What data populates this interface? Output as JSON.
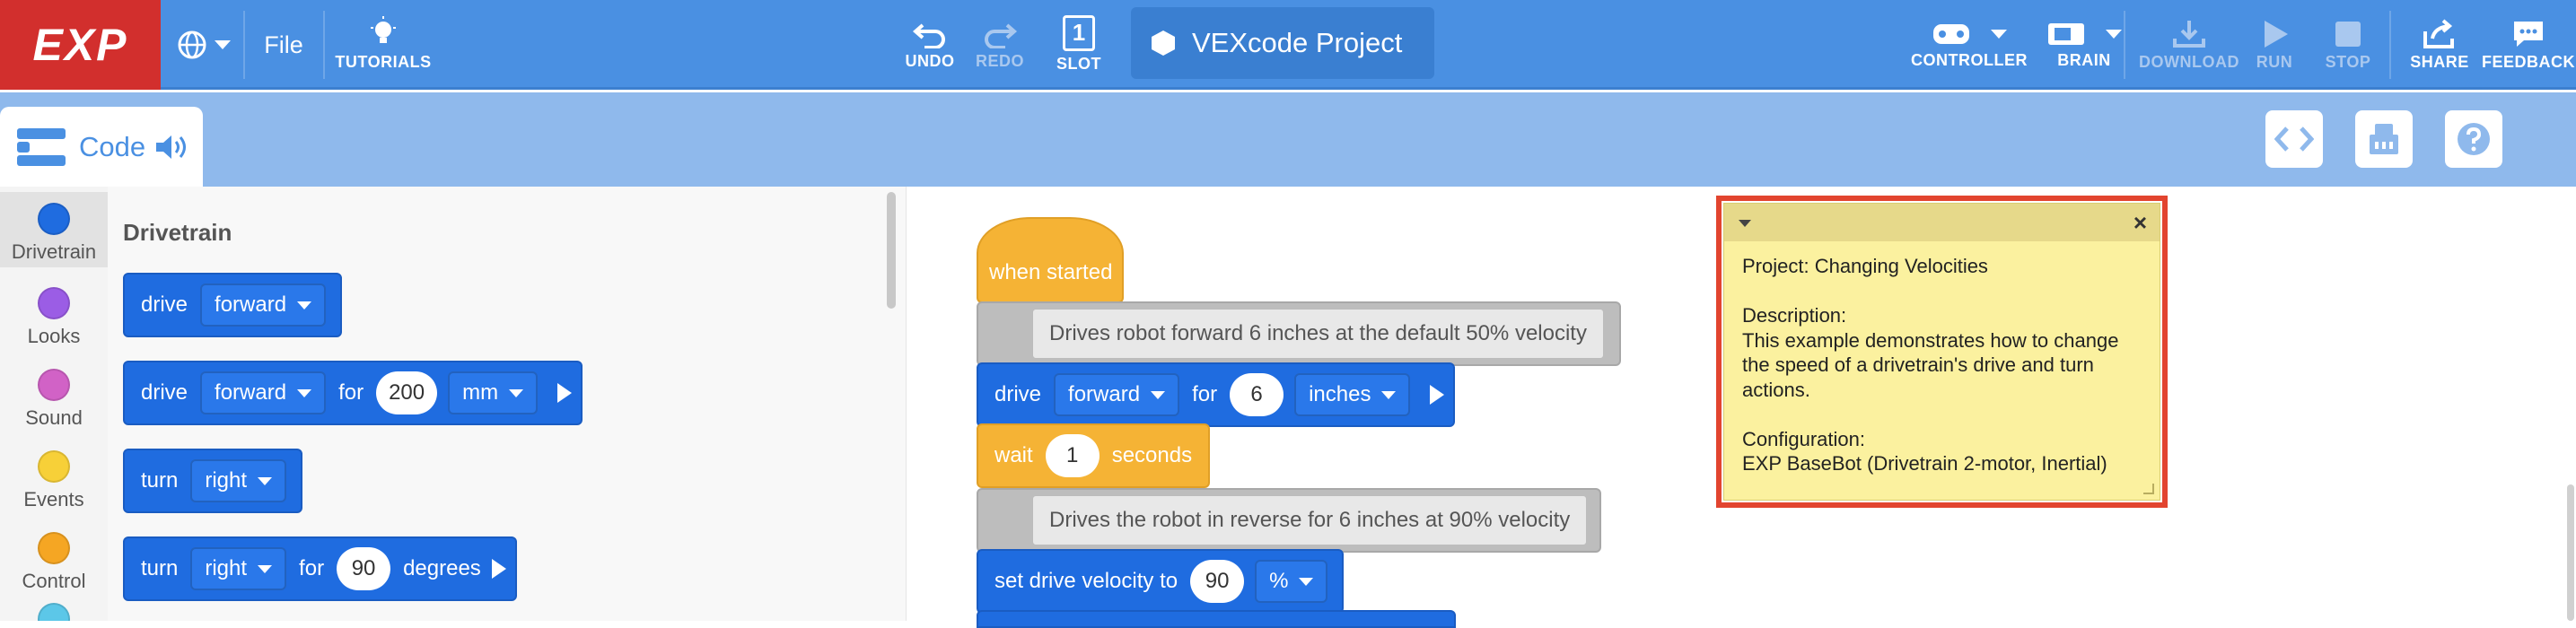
{
  "app": {
    "logo": "EXP",
    "file_menu": "File",
    "tutorials_label": "TUTORIALS",
    "undo_label": "UNDO",
    "redo_label": "REDO",
    "slot_label": "SLOT",
    "slot_number": "1",
    "project_name": "VEXcode Project",
    "controller_label": "CONTROLLER",
    "brain_label": "BRAIN",
    "download_label": "DOWNLOAD",
    "run_label": "RUN",
    "stop_label": "STOP",
    "share_label": "SHARE",
    "feedback_label": "FEEDBACK"
  },
  "subbar": {
    "code_tab": "Code"
  },
  "categories": [
    {
      "label": "Drivetrain",
      "color": "#1f6ce0"
    },
    {
      "label": "Looks",
      "color": "#9b5de5"
    },
    {
      "label": "Sound",
      "color": "#d162c6"
    },
    {
      "label": "Events",
      "color": "#f7d038"
    },
    {
      "label": "Control",
      "color": "#f5a623"
    }
  ],
  "palette": {
    "title": "Drivetrain",
    "blocks": [
      {
        "word": "drive",
        "dropdown": "forward"
      },
      {
        "word": "drive",
        "dropdown": "forward",
        "for": "for",
        "value": "200",
        "unit": "mm"
      },
      {
        "word": "turn",
        "dropdown": "right"
      },
      {
        "word": "turn",
        "dropdown": "right",
        "for": "for",
        "value": "90",
        "unit": "degrees"
      }
    ]
  },
  "workspace": {
    "hat": "when started",
    "comment1": "Drives robot forward 6 inches at the default 50% velocity",
    "drive": {
      "word": "drive",
      "dropdown": "forward",
      "for": "for",
      "value": "6",
      "unit": "inches"
    },
    "wait": {
      "word": "wait",
      "value": "1",
      "unit": "seconds"
    },
    "comment2": "Drives the robot in reverse for 6 inches at 90% velocity",
    "velocity": {
      "word": "set drive velocity to",
      "value": "90",
      "unit": "%"
    }
  },
  "note": {
    "lines": [
      "Project: Changing Velocities",
      "",
      "Description:",
      "This example demonstrates how to change",
      "the speed of a drivetrain's drive and turn",
      "actions.",
      "",
      "Configuration:",
      "EXP BaseBot (Drivetrain 2-motor, Inertial)"
    ]
  },
  "colors": {
    "topbar": "#4a90e2",
    "logo_bg": "#d22f2d",
    "drivetrain_block": "#1f6ce0",
    "control_block": "#f5b335",
    "note_bg": "#fbf19f",
    "highlight": "#e2442f"
  }
}
